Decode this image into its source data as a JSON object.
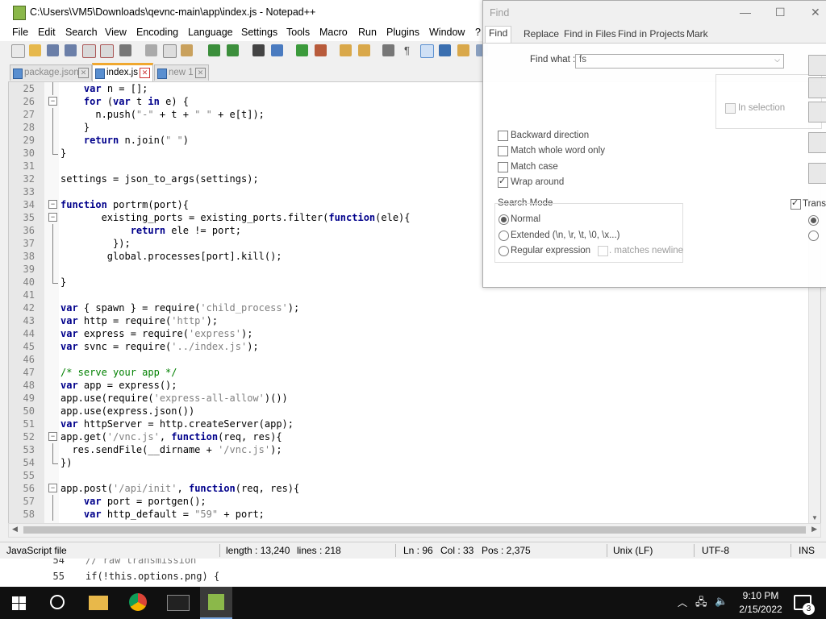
{
  "window": {
    "title": "C:\\Users\\VM5\\Downloads\\qevnc-main\\app\\index.js - Notepad++"
  },
  "menu": [
    "File",
    "Edit",
    "Search",
    "View",
    "Encoding",
    "Language",
    "Settings",
    "Tools",
    "Macro",
    "Run",
    "Plugins",
    "Window",
    "?"
  ],
  "tabs": [
    {
      "label": "package.json",
      "active": false
    },
    {
      "label": "index.js",
      "active": true
    },
    {
      "label": "new 1",
      "active": false
    }
  ],
  "editor": {
    "lines": [
      {
        "n": "25",
        "html": "    <span class='kw'>var</span> n = [];"
      },
      {
        "n": "26",
        "html": "    <span class='kw'>for</span> (<span class='kw'>var</span> t <span class='kw'>in</span> e) {"
      },
      {
        "n": "27",
        "html": "      n.push(<span class='str'>\"-\"</span> + t + <span class='str'>\" \"</span> + e[t]);"
      },
      {
        "n": "28",
        "html": "    }"
      },
      {
        "n": "29",
        "html": "    <span class='kw'>return</span> n.join(<span class='str'>\" \"</span>)"
      },
      {
        "n": "30",
        "html": "}"
      },
      {
        "n": "31",
        "html": ""
      },
      {
        "n": "32",
        "html": "settings = json_to_args(settings);"
      },
      {
        "n": "33",
        "html": ""
      },
      {
        "n": "34",
        "html": "<span class='kw'>function</span> portrm(port){"
      },
      {
        "n": "35",
        "html": "       existing_ports = existing_ports.filter(<span class='kw'>function</span>(ele){"
      },
      {
        "n": "36",
        "html": "            <span class='kw'>return</span> ele != port;"
      },
      {
        "n": "37",
        "html": "         });"
      },
      {
        "n": "38",
        "html": "        global.processes[port].kill();"
      },
      {
        "n": "39",
        "html": ""
      },
      {
        "n": "40",
        "html": "}"
      },
      {
        "n": "41",
        "html": ""
      },
      {
        "n": "42",
        "html": "<span class='kw'>var</span> { spawn } = require(<span class='str'>'child_process'</span>);"
      },
      {
        "n": "43",
        "html": "<span class='kw'>var</span> http = require(<span class='str'>'http'</span>);"
      },
      {
        "n": "44",
        "html": "<span class='kw'>var</span> express = require(<span class='str'>'express'</span>);"
      },
      {
        "n": "45",
        "html": "<span class='kw'>var</span> svnc = require(<span class='str'>'../index.js'</span>);"
      },
      {
        "n": "46",
        "html": ""
      },
      {
        "n": "47",
        "html": "<span class='cmt'>/* serve your app */</span>"
      },
      {
        "n": "48",
        "html": "<span class='kw'>var</span> app = express();"
      },
      {
        "n": "49",
        "html": "app.use(require(<span class='str'>'express-all-allow'</span>)())"
      },
      {
        "n": "50",
        "html": "app.use(express.json())"
      },
      {
        "n": "51",
        "html": "<span class='kw'>var</span> httpServer = http.createServer(app);"
      },
      {
        "n": "52",
        "html": "app.get(<span class='str'>'/vnc.js'</span>, <span class='kw'>function</span>(req, res){"
      },
      {
        "n": "53",
        "html": "  res.sendFile(__dirname + <span class='str'>'/vnc.js'</span>);"
      },
      {
        "n": "54",
        "html": "})"
      },
      {
        "n": "55",
        "html": ""
      },
      {
        "n": "56",
        "html": "app.post(<span class='str'>'/api/init'</span>, <span class='kw'>function</span>(req, res){"
      },
      {
        "n": "57",
        "html": "    <span class='kw'>var</span> port = portgen();"
      },
      {
        "n": "58",
        "html": "    <span class='kw'>var</span> http_default = <span class='str'>\"59\"</span> + port;"
      }
    ]
  },
  "statusbar": {
    "filetype": "JavaScript file",
    "length": "length : 13,240",
    "lines": "lines : 218",
    "ln": "Ln : 96",
    "col": "Col : 33",
    "pos": "Pos : 2,375",
    "eol": "Unix (LF)",
    "encoding": "UTF-8",
    "mode": "INS"
  },
  "background_editor": {
    "lines": [
      {
        "n": "54",
        "code": "// raw transmission"
      },
      {
        "n": "55",
        "code": "if(!this.options.png) {"
      }
    ]
  },
  "find_dialog": {
    "title": "Find",
    "tabs": [
      "Find",
      "Replace",
      "Find in Files",
      "Find in Projects",
      "Mark"
    ],
    "find_what_label": "Find what :",
    "find_what_value": "fs",
    "in_selection": "In selection",
    "options": [
      {
        "label": "Backward direction",
        "checked": false
      },
      {
        "label": "Match whole word only",
        "checked": false
      },
      {
        "label": "Match case",
        "checked": false
      },
      {
        "label": "Wrap around",
        "checked": true
      }
    ],
    "search_mode_label": "Search Mode",
    "modes": [
      {
        "label": "Normal",
        "checked": true
      },
      {
        "label": "Extended (\\n, \\r, \\t, \\0, \\x...)",
        "checked": false
      },
      {
        "label": "Regular expression",
        "checked": false
      }
    ],
    "matches_newline": ". matches newline",
    "transparency_label": "Transp"
  },
  "taskbar": {
    "time": "9:10 PM",
    "date": "2/15/2022",
    "notification_count": "3"
  }
}
